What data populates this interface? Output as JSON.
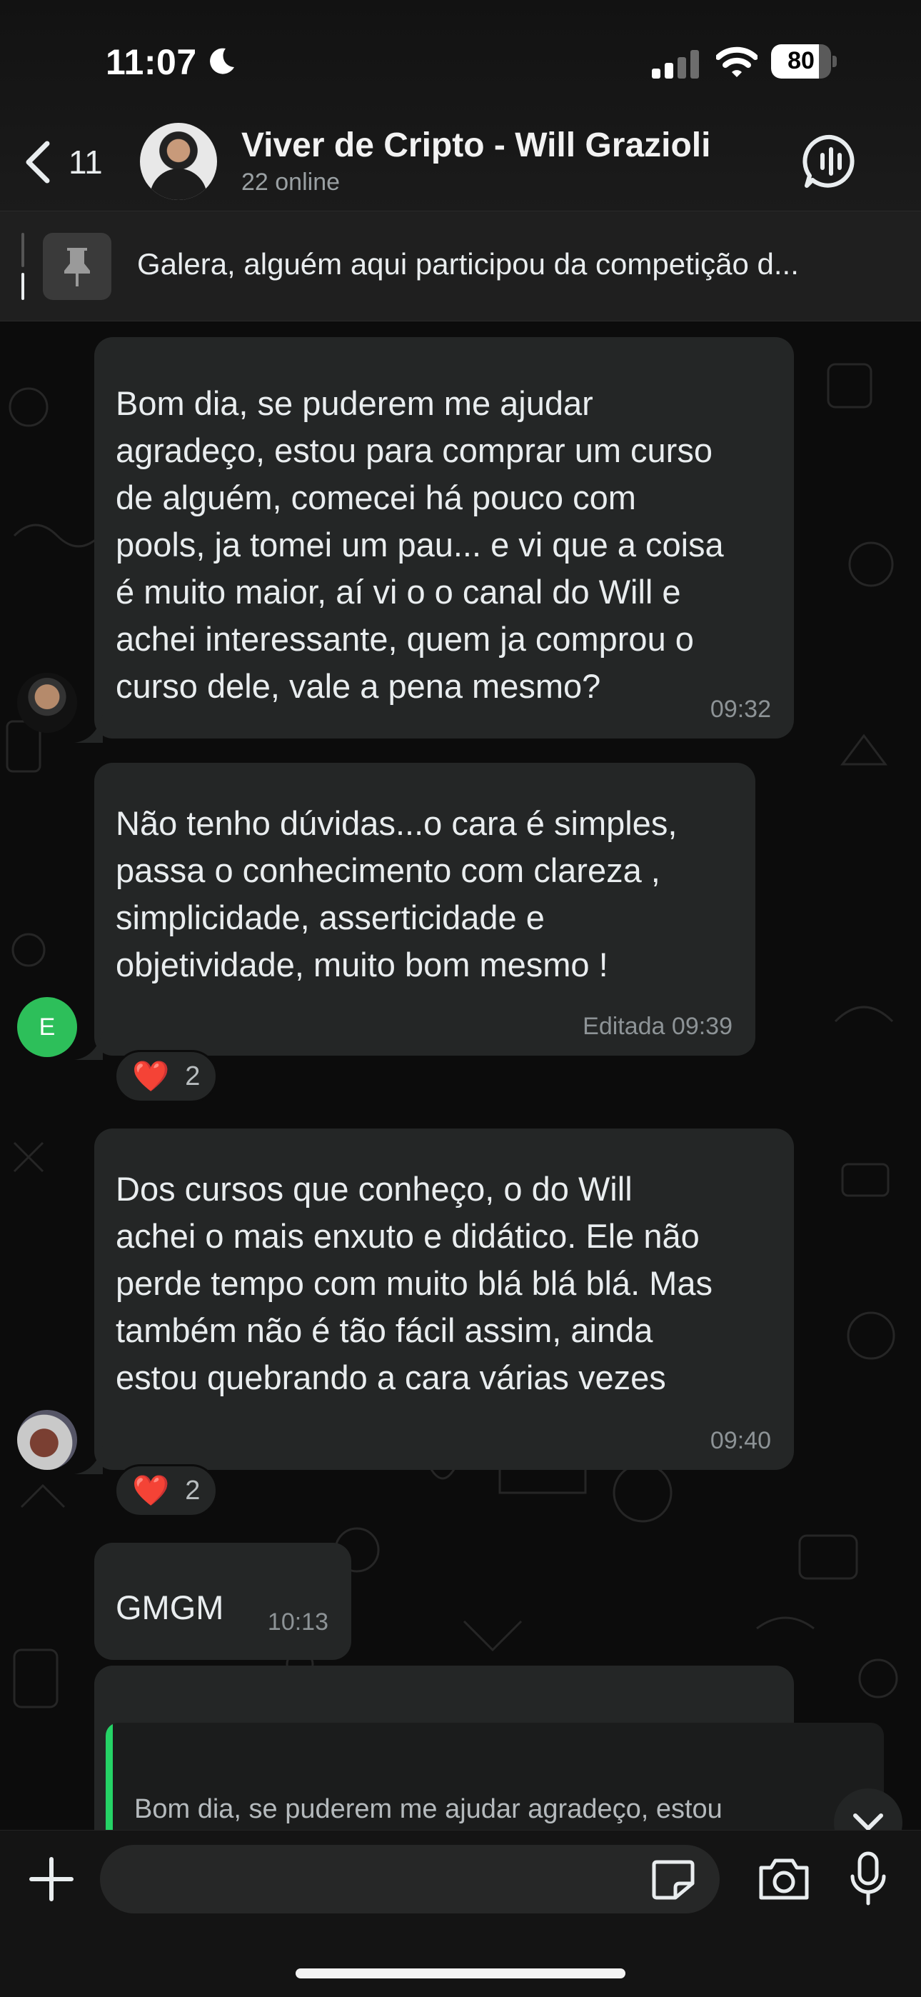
{
  "status_bar": {
    "time": "11:07",
    "battery": "80",
    "battery_level_percent": 80
  },
  "header": {
    "back_count": "11",
    "title": "Viver de Cripto - Will Grazioli",
    "subtitle": "22 online",
    "icons": {
      "back": "chevron-left-icon",
      "call": "group-call-icon"
    }
  },
  "pinned": {
    "text": "Galera, alguém aqui participou da competição d..."
  },
  "messages": [
    {
      "text": "Bom dia, se puderem me ajudar\nagradeço, estou para comprar um curso\nde alguém, comecei há pouco com\npools, ja tomei um pau... e vi que a coisa\né muito maior, aí vi o  o canal do Will e\nachei interessante, quem ja comprou o\ncurso dele, vale a pena mesmo?",
      "time": "09:32"
    },
    {
      "text": "Não tenho dúvidas...o cara é simples,\npassa o conhecimento com clareza ,\nsimplicidade, asserticidade e\nobjetividade, muito bom mesmo !",
      "time": "Editada 09:39",
      "avatar_letter": "E",
      "reaction": {
        "emoji": "❤️",
        "count": "2"
      }
    },
    {
      "text": "Dos cursos que conheço, o do Will\nachei o mais enxuto e didático.  Ele não\nperde tempo com muito blá blá blá. Mas\ntambém não é tão fácil assim, ainda\nestou quebrando a cara várias vezes",
      "time": "09:40",
      "reaction": {
        "emoji": "❤️",
        "count": "2"
      }
    },
    {
      "text": "GMGM",
      "time": "10:13"
    },
    {
      "quote": "Bom dia, se puderem me ajudar agradeço, estou"
    }
  ],
  "composer": {
    "placeholder": ""
  },
  "colors": {
    "bubble": "#242626",
    "accent": "#25d366",
    "heart": "#e0232f",
    "background": "#0c0c0c"
  }
}
